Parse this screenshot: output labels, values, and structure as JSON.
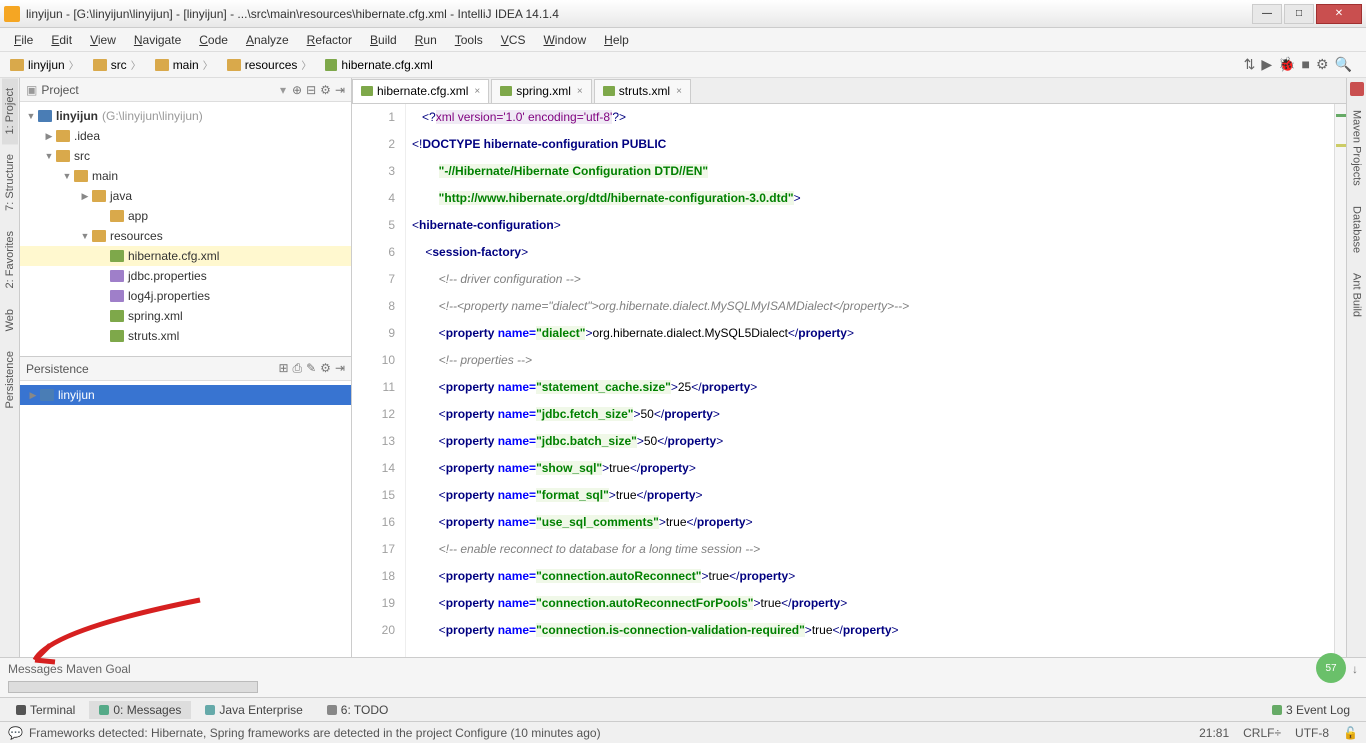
{
  "window": {
    "title": "linyijun - [G:\\linyijun\\linyijun] - [linyijun] - ...\\src\\main\\resources\\hibernate.cfg.xml - IntelliJ IDEA 14.1.4"
  },
  "menu": [
    "File",
    "Edit",
    "View",
    "Navigate",
    "Code",
    "Analyze",
    "Refactor",
    "Build",
    "Run",
    "Tools",
    "VCS",
    "Window",
    "Help"
  ],
  "breadcrumbs": [
    {
      "label": "linyijun",
      "icon": "folder"
    },
    {
      "label": "src",
      "icon": "folder"
    },
    {
      "label": "main",
      "icon": "folder"
    },
    {
      "label": "resources",
      "icon": "folder"
    },
    {
      "label": "hibernate.cfg.xml",
      "icon": "xml"
    }
  ],
  "leftTabs": [
    "1: Project",
    "7: Structure",
    "2: Favorites",
    "Web",
    "Persistence"
  ],
  "projectHeader": "Project",
  "tree": {
    "root": {
      "name": "linyijun",
      "hint": "(G:\\linyijun\\linyijun)"
    },
    "nodes": [
      {
        "indent": 1,
        "arrow": "▶",
        "icon": "folder",
        "name": ".idea"
      },
      {
        "indent": 1,
        "arrow": "▼",
        "icon": "folder",
        "name": "src"
      },
      {
        "indent": 2,
        "arrow": "▼",
        "icon": "folder",
        "name": "main"
      },
      {
        "indent": 3,
        "arrow": "▶",
        "icon": "folder",
        "name": "java"
      },
      {
        "indent": 4,
        "arrow": "",
        "icon": "folder",
        "name": "app"
      },
      {
        "indent": 3,
        "arrow": "▼",
        "icon": "folder",
        "name": "resources"
      },
      {
        "indent": 4,
        "arrow": "",
        "icon": "xml",
        "name": "hibernate.cfg.xml",
        "sel": true
      },
      {
        "indent": 4,
        "arrow": "",
        "icon": "prop",
        "name": "jdbc.properties"
      },
      {
        "indent": 4,
        "arrow": "",
        "icon": "prop",
        "name": "log4j.properties"
      },
      {
        "indent": 4,
        "arrow": "",
        "icon": "xml",
        "name": "spring.xml"
      },
      {
        "indent": 4,
        "arrow": "",
        "icon": "xml",
        "name": "struts.xml"
      }
    ]
  },
  "persistHeader": "Persistence",
  "persistRoot": "linyijun",
  "editorTabs": [
    {
      "label": "hibernate.cfg.xml",
      "icon": "xml",
      "active": true
    },
    {
      "label": "spring.xml",
      "icon": "xml"
    },
    {
      "label": "struts.xml",
      "icon": "xml"
    }
  ],
  "code": {
    "lines": [
      {
        "n": 1,
        "html": "   <span class='t-br'>&lt;?</span><span class='t-pi'>xml version='1.0' encoding='utf-8'</span><span class='t-br'>?&gt;</span>"
      },
      {
        "n": 2,
        "html": "<span class='t-br'>&lt;!</span><span class='t-tag'>DOCTYPE hibernate-configuration PUBLIC</span>"
      },
      {
        "n": 3,
        "html": "        <span class='t-val'>\"-//Hibernate/Hibernate Configuration DTD//EN\"</span>"
      },
      {
        "n": 4,
        "html": "        <span class='t-val'>\"http://www.hibernate.org/dtd/hibernate-configuration-3.0.dtd\"</span><span class='t-br'>&gt;</span>"
      },
      {
        "n": 5,
        "html": "<span class='t-br'>&lt;</span><span class='t-tag'>hibernate-configuration</span><span class='t-br'>&gt;</span>"
      },
      {
        "n": 6,
        "html": "    <span class='t-br'>&lt;</span><span class='t-tag'>session-factory</span><span class='t-br'>&gt;</span>"
      },
      {
        "n": 7,
        "html": "        <span class='t-cmt'>&lt;!-- driver configuration --&gt;</span>"
      },
      {
        "n": 8,
        "html": "        <span class='t-cmt'>&lt;!--&lt;property name=\"dialect\"&gt;org.hibernate.dialect.MySQLMyISAMDialect&lt;/property&gt;--&gt;</span>"
      },
      {
        "n": 9,
        "html": "        <span class='t-br'>&lt;</span><span class='t-tag'>property </span><span class='t-attr'>name=</span><span class='t-val'>\"dialect\"</span><span class='t-br'>&gt;</span><span class='t-txt'>org.hibernate.dialect.MySQL5Dialect</span><span class='t-br'>&lt;/</span><span class='t-tag'>property</span><span class='t-br'>&gt;</span>"
      },
      {
        "n": 10,
        "html": "        <span class='t-cmt'>&lt;!-- properties --&gt;</span>"
      },
      {
        "n": 11,
        "html": "        <span class='t-br'>&lt;</span><span class='t-tag'>property </span><span class='t-attr'>name=</span><span class='t-val'>\"statement_cache.size\"</span><span class='t-br'>&gt;</span><span class='t-txt'>25</span><span class='t-br'>&lt;/</span><span class='t-tag'>property</span><span class='t-br'>&gt;</span>"
      },
      {
        "n": 12,
        "html": "        <span class='t-br'>&lt;</span><span class='t-tag'>property </span><span class='t-attr'>name=</span><span class='t-val'>\"jdbc.fetch_size\"</span><span class='t-br'>&gt;</span><span class='t-txt'>50</span><span class='t-br'>&lt;/</span><span class='t-tag'>property</span><span class='t-br'>&gt;</span>"
      },
      {
        "n": 13,
        "html": "        <span class='t-br'>&lt;</span><span class='t-tag'>property </span><span class='t-attr'>name=</span><span class='t-val'>\"jdbc.batch_size\"</span><span class='t-br'>&gt;</span><span class='t-txt'>50</span><span class='t-br'>&lt;/</span><span class='t-tag'>property</span><span class='t-br'>&gt;</span>"
      },
      {
        "n": 14,
        "html": "        <span class='t-br'>&lt;</span><span class='t-tag'>property </span><span class='t-attr'>name=</span><span class='t-val'>\"show_sql\"</span><span class='t-br'>&gt;</span><span class='t-txt'>true</span><span class='t-br'>&lt;/</span><span class='t-tag'>property</span><span class='t-br'>&gt;</span>"
      },
      {
        "n": 15,
        "html": "        <span class='t-br'>&lt;</span><span class='t-tag'>property </span><span class='t-attr'>name=</span><span class='t-val'>\"format_sql\"</span><span class='t-br'>&gt;</span><span class='t-txt'>true</span><span class='t-br'>&lt;/</span><span class='t-tag'>property</span><span class='t-br'>&gt;</span>"
      },
      {
        "n": 16,
        "html": "        <span class='t-br'>&lt;</span><span class='t-tag'>property </span><span class='t-attr'>name=</span><span class='t-val'>\"use_sql_comments\"</span><span class='t-br'>&gt;</span><span class='t-txt'>true</span><span class='t-br'>&lt;/</span><span class='t-tag'>property</span><span class='t-br'>&gt;</span>"
      },
      {
        "n": 17,
        "html": "        <span class='t-cmt'>&lt;!-- enable reconnect to database for a long time session --&gt;</span>"
      },
      {
        "n": 18,
        "html": "        <span class='t-br'>&lt;</span><span class='t-tag'>property </span><span class='t-attr'>name=</span><span class='t-val'>\"connection.autoReconnect\"</span><span class='t-br'>&gt;</span><span class='t-txt'>true</span><span class='t-br'>&lt;/</span><span class='t-tag'>property</span><span class='t-br'>&gt;</span>"
      },
      {
        "n": 19,
        "html": "        <span class='t-br'>&lt;</span><span class='t-tag'>property </span><span class='t-attr'>name=</span><span class='t-val'>\"connection.autoReconnectForPools\"</span><span class='t-br'>&gt;</span><span class='t-txt'>true</span><span class='t-br'>&lt;/</span><span class='t-tag'>property</span><span class='t-br'>&gt;</span>"
      },
      {
        "n": 20,
        "html": "        <span class='t-br'>&lt;</span><span class='t-tag'>property </span><span class='t-attr'>name=</span><span class='t-val'>\"connection.is-connection-validation-required\"</span><span class='t-br'>&gt;</span><span class='t-txt'>true</span><span class='t-br'>&lt;/</span><span class='t-tag'>property</span><span class='t-br'>&gt;</span>"
      }
    ]
  },
  "rightTabs": [
    "Maven Projects",
    "Database",
    "Ant Build"
  ],
  "msgHeader": "Messages Maven Goal",
  "bottomTabs": [
    {
      "label": "Terminal",
      "icon": "#555"
    },
    {
      "label": "0: Messages",
      "icon": "#5a8",
      "active": true
    },
    {
      "label": "Java Enterprise",
      "icon": "#6aa"
    },
    {
      "label": "6: TODO",
      "icon": "#888"
    }
  ],
  "eventLog": "3 Event Log",
  "status": {
    "msg": "Frameworks detected: Hibernate, Spring frameworks are detected in the project Configure (10 minutes ago)",
    "pos": "21:81",
    "enc": "CRLF÷",
    "charset": "UTF-8"
  },
  "greenBadge": "57"
}
